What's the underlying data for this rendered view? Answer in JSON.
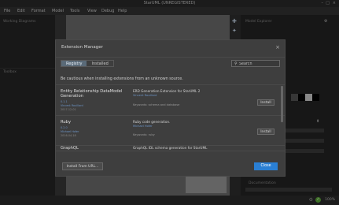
{
  "window": {
    "title": "StarUML (UNREGISTERED)"
  },
  "menu": [
    "File",
    "Edit",
    "Format",
    "Model",
    "Tools",
    "View",
    "Debug",
    "Help"
  ],
  "panels": {
    "working_diagrams": "Working Diagrams",
    "toolbox": "Toolbox",
    "model_explorer": "Model Explorer",
    "documentation": "Documentation"
  },
  "status": {
    "zoom": "100%"
  },
  "colors": {
    "accent": "#2a7fd4",
    "link": "#6d94c6",
    "ok": "#5fae3a"
  },
  "modal": {
    "title": "Extension Manager",
    "close_icon": "×",
    "tabs": [
      {
        "label": "Registry",
        "active": true
      },
      {
        "label": "Installed",
        "active": false
      }
    ],
    "search": {
      "placeholder": "Search",
      "value": ""
    },
    "warning": "Be cautious when installing extensions from an unknown source.",
    "extensions": [
      {
        "name": "Entity Relationship DataModel Generation",
        "version": "0.1.1",
        "author": "Vincent Rouillard",
        "date": "2017-12-01",
        "description": "ERD Generation Extension for StarUML 2",
        "link": "Vincent Rouillard",
        "keywords": "Keywords: schema and database",
        "install_label": "Install"
      },
      {
        "name": "Ruby",
        "version": "0.2.0",
        "author": "Michael Hofer",
        "date": "2016-04-18",
        "description": "Ruby code generation.",
        "link": "Michael Hofer",
        "keywords": "Keywords: ruby",
        "install_label": "Install"
      },
      {
        "name": "GraphQL",
        "description": "GraphQL IDL schema generation for StarUML"
      }
    ],
    "install_from_url": "Install From URL...",
    "close_label": "Close"
  }
}
